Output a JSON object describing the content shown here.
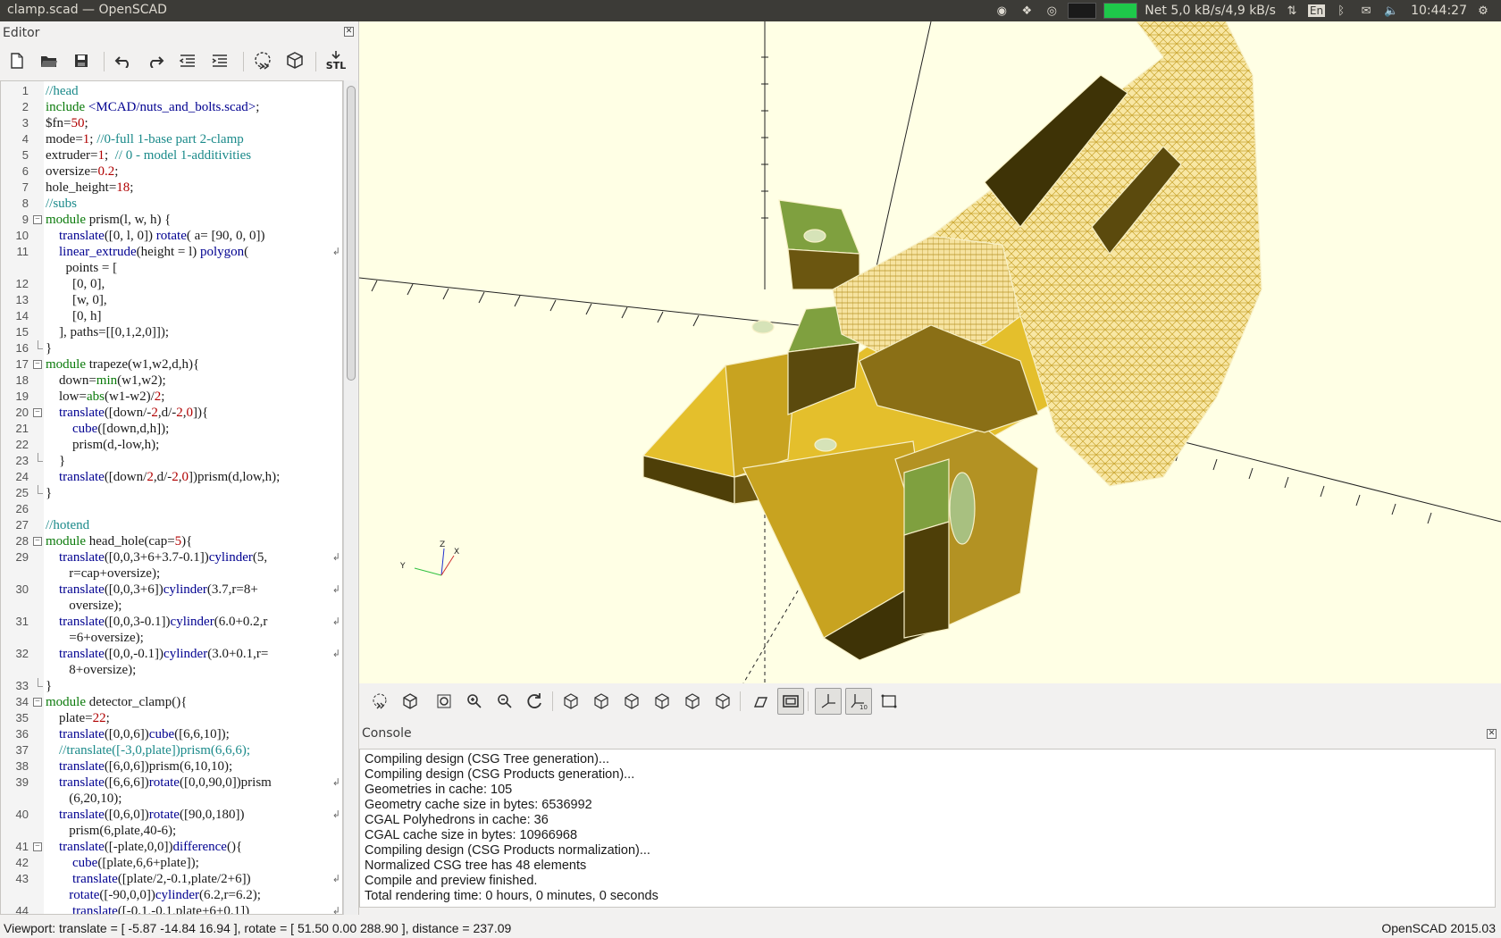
{
  "window": {
    "title": "clamp.scad — OpenSCAD"
  },
  "tray": {
    "net": "Net 5,0 kB/s/4,9 kB/s",
    "lang": "En",
    "time": "10:44:27"
  },
  "editor": {
    "title": "Editor",
    "toolbar": [
      "new-file-icon",
      "open-file-icon",
      "save-icon",
      "undo-icon",
      "redo-icon",
      "unindent-icon",
      "indent-icon",
      "preview-icon",
      "render-icon",
      "export-stl-icon"
    ],
    "stl_label": "STL",
    "lines": [
      {
        "n": "1",
        "fold": "",
        "segs": [
          [
            "c",
            "//head"
          ]
        ]
      },
      {
        "n": "2",
        "fold": "",
        "segs": [
          [
            "k",
            "include"
          ],
          [
            "t",
            " "
          ],
          [
            "f",
            "<MCAD/nuts_and_bolts.scad>"
          ],
          [
            "t",
            ";"
          ]
        ]
      },
      {
        "n": "3",
        "fold": "",
        "segs": [
          [
            "t",
            "$fn="
          ],
          [
            "n",
            "50"
          ],
          [
            "t",
            ";"
          ]
        ]
      },
      {
        "n": "4",
        "fold": "",
        "segs": [
          [
            "t",
            "mode="
          ],
          [
            "n",
            "1"
          ],
          [
            "t",
            "; "
          ],
          [
            "c",
            "//0-full 1-base part 2-clamp"
          ]
        ]
      },
      {
        "n": "5",
        "fold": "",
        "segs": [
          [
            "t",
            "extruder="
          ],
          [
            "n",
            "1"
          ],
          [
            "t",
            ";  "
          ],
          [
            "c",
            "// 0 - model 1-additivities"
          ]
        ]
      },
      {
        "n": "6",
        "fold": "",
        "segs": [
          [
            "t",
            "oversize="
          ],
          [
            "n",
            "0.2"
          ],
          [
            "t",
            ";"
          ]
        ]
      },
      {
        "n": "7",
        "fold": "",
        "segs": [
          [
            "t",
            "hole_height="
          ],
          [
            "n",
            "18"
          ],
          [
            "t",
            ";"
          ]
        ]
      },
      {
        "n": "8",
        "fold": "",
        "segs": [
          [
            "c",
            "//subs"
          ]
        ]
      },
      {
        "n": "9",
        "fold": "open",
        "segs": [
          [
            "k",
            "module"
          ],
          [
            "t",
            " prism(l, w, h) {"
          ]
        ]
      },
      {
        "n": "10",
        "fold": "",
        "segs": [
          [
            "t",
            "    "
          ],
          [
            "f",
            "translate"
          ],
          [
            "t",
            "([0, l, 0]) "
          ],
          [
            "f",
            "rotate"
          ],
          [
            "t",
            "( a= [90, 0, 0])"
          ]
        ]
      },
      {
        "n": "11",
        "fold": "",
        "wrap": true,
        "segs": [
          [
            "t",
            "    "
          ],
          [
            "f",
            "linear_extrude"
          ],
          [
            "t",
            "(height = l) "
          ],
          [
            "f",
            "polygon"
          ],
          [
            "t",
            "("
          ]
        ]
      },
      {
        "n": "",
        "fold": "",
        "segs": [
          [
            "t",
            "      points = ["
          ]
        ]
      },
      {
        "n": "12",
        "fold": "",
        "segs": [
          [
            "t",
            "        [0, 0],"
          ]
        ]
      },
      {
        "n": "13",
        "fold": "",
        "segs": [
          [
            "t",
            "        [w, 0],"
          ]
        ]
      },
      {
        "n": "14",
        "fold": "",
        "segs": [
          [
            "t",
            "        [0, h]"
          ]
        ]
      },
      {
        "n": "15",
        "fold": "",
        "segs": [
          [
            "t",
            "    ], paths=[[0,1,2,0]]);"
          ]
        ]
      },
      {
        "n": "16",
        "fold": "end",
        "segs": [
          [
            "t",
            "}"
          ]
        ]
      },
      {
        "n": "17",
        "fold": "open",
        "segs": [
          [
            "k",
            "module"
          ],
          [
            "t",
            " trapeze(w1,w2,d,h){"
          ]
        ]
      },
      {
        "n": "18",
        "fold": "",
        "segs": [
          [
            "t",
            "    down="
          ],
          [
            "k",
            "min"
          ],
          [
            "t",
            "(w1,w2);"
          ]
        ]
      },
      {
        "n": "19",
        "fold": "",
        "segs": [
          [
            "t",
            "    low="
          ],
          [
            "k",
            "abs"
          ],
          [
            "t",
            "(w1-w2)/"
          ],
          [
            "n",
            "2"
          ],
          [
            "t",
            ";"
          ]
        ]
      },
      {
        "n": "20",
        "fold": "open",
        "segs": [
          [
            "t",
            "    "
          ],
          [
            "f",
            "translate"
          ],
          [
            "t",
            "([down/-"
          ],
          [
            "n",
            "2"
          ],
          [
            "t",
            ",d/-"
          ],
          [
            "n",
            "2"
          ],
          [
            "t",
            ","
          ],
          [
            "n",
            "0"
          ],
          [
            "t",
            "]){"
          ]
        ]
      },
      {
        "n": "21",
        "fold": "",
        "segs": [
          [
            "t",
            "        "
          ],
          [
            "f",
            "cube"
          ],
          [
            "t",
            "([down,d,h]);"
          ]
        ]
      },
      {
        "n": "22",
        "fold": "",
        "segs": [
          [
            "t",
            "        prism(d,-low,h);"
          ]
        ]
      },
      {
        "n": "23",
        "fold": "end",
        "segs": [
          [
            "t",
            "    }"
          ]
        ]
      },
      {
        "n": "24",
        "fold": "",
        "segs": [
          [
            "t",
            "    "
          ],
          [
            "f",
            "translate"
          ],
          [
            "t",
            "([down/"
          ],
          [
            "n",
            "2"
          ],
          [
            "t",
            ",d/-"
          ],
          [
            "n",
            "2"
          ],
          [
            "t",
            ","
          ],
          [
            "n",
            "0"
          ],
          [
            "t",
            "])prism(d,low,h);"
          ]
        ]
      },
      {
        "n": "25",
        "fold": "end",
        "segs": [
          [
            "t",
            "}"
          ]
        ]
      },
      {
        "n": "26",
        "fold": "",
        "segs": [
          [
            "t",
            ""
          ]
        ]
      },
      {
        "n": "27",
        "fold": "",
        "segs": [
          [
            "c",
            "//hotend"
          ]
        ]
      },
      {
        "n": "28",
        "fold": "open",
        "segs": [
          [
            "k",
            "module"
          ],
          [
            "t",
            " head_hole(cap="
          ],
          [
            "n",
            "5"
          ],
          [
            "t",
            "){"
          ]
        ]
      },
      {
        "n": "29",
        "fold": "",
        "wrap": true,
        "segs": [
          [
            "t",
            "    "
          ],
          [
            "f",
            "translate"
          ],
          [
            "t",
            "([0,0,3+6+3.7-0.1])"
          ],
          [
            "f",
            "cylinder"
          ],
          [
            "t",
            "(5,"
          ]
        ]
      },
      {
        "n": "",
        "fold": "",
        "segs": [
          [
            "t",
            "       r=cap+oversize);"
          ]
        ]
      },
      {
        "n": "30",
        "fold": "",
        "wrap": true,
        "segs": [
          [
            "t",
            "    "
          ],
          [
            "f",
            "translate"
          ],
          [
            "t",
            "([0,0,3+6])"
          ],
          [
            "f",
            "cylinder"
          ],
          [
            "t",
            "(3.7,r=8+"
          ]
        ]
      },
      {
        "n": "",
        "fold": "",
        "segs": [
          [
            "t",
            "       oversize);"
          ]
        ]
      },
      {
        "n": "31",
        "fold": "",
        "wrap": true,
        "segs": [
          [
            "t",
            "    "
          ],
          [
            "f",
            "translate"
          ],
          [
            "t",
            "([0,0,3-0.1])"
          ],
          [
            "f",
            "cylinder"
          ],
          [
            "t",
            "(6.0+0.2,r"
          ]
        ]
      },
      {
        "n": "",
        "fold": "",
        "segs": [
          [
            "t",
            "       =6+oversize);"
          ]
        ]
      },
      {
        "n": "32",
        "fold": "",
        "wrap": true,
        "segs": [
          [
            "t",
            "    "
          ],
          [
            "f",
            "translate"
          ],
          [
            "t",
            "([0,0,-0.1])"
          ],
          [
            "f",
            "cylinder"
          ],
          [
            "t",
            "(3.0+0.1,r="
          ]
        ]
      },
      {
        "n": "",
        "fold": "",
        "segs": [
          [
            "t",
            "       8+oversize);"
          ]
        ]
      },
      {
        "n": "33",
        "fold": "end",
        "segs": [
          [
            "t",
            "}"
          ]
        ]
      },
      {
        "n": "34",
        "fold": "open",
        "segs": [
          [
            "k",
            "module"
          ],
          [
            "t",
            " detector_clamp(){"
          ]
        ]
      },
      {
        "n": "35",
        "fold": "",
        "segs": [
          [
            "t",
            "    plate="
          ],
          [
            "n",
            "22"
          ],
          [
            "t",
            ";"
          ]
        ]
      },
      {
        "n": "36",
        "fold": "",
        "segs": [
          [
            "t",
            "    "
          ],
          [
            "f",
            "translate"
          ],
          [
            "t",
            "([0,0,6])"
          ],
          [
            "f",
            "cube"
          ],
          [
            "t",
            "([6,6,10]);"
          ]
        ]
      },
      {
        "n": "37",
        "fold": "",
        "segs": [
          [
            "t",
            "    "
          ],
          [
            "c",
            "//translate([-3,0,plate])prism(6,6,6);"
          ]
        ]
      },
      {
        "n": "38",
        "fold": "",
        "segs": [
          [
            "t",
            "    "
          ],
          [
            "f",
            "translate"
          ],
          [
            "t",
            "([6,0,6])prism(6,10,10);"
          ]
        ]
      },
      {
        "n": "39",
        "fold": "",
        "wrap": true,
        "segs": [
          [
            "t",
            "    "
          ],
          [
            "f",
            "translate"
          ],
          [
            "t",
            "([6,6,6])"
          ],
          [
            "f",
            "rotate"
          ],
          [
            "t",
            "([0,0,90,0])prism"
          ]
        ]
      },
      {
        "n": "",
        "fold": "",
        "segs": [
          [
            "t",
            "       (6,20,10);"
          ]
        ]
      },
      {
        "n": "40",
        "fold": "",
        "wrap": true,
        "segs": [
          [
            "t",
            "    "
          ],
          [
            "f",
            "translate"
          ],
          [
            "t",
            "([0,6,0])"
          ],
          [
            "f",
            "rotate"
          ],
          [
            "t",
            "([90,0,180])"
          ]
        ]
      },
      {
        "n": "",
        "fold": "",
        "segs": [
          [
            "t",
            "       prism(6,plate,40-6);"
          ]
        ]
      },
      {
        "n": "41",
        "fold": "open",
        "segs": [
          [
            "t",
            "    "
          ],
          [
            "f",
            "translate"
          ],
          [
            "t",
            "([-plate,0,0])"
          ],
          [
            "f",
            "difference"
          ],
          [
            "t",
            "(){"
          ]
        ]
      },
      {
        "n": "42",
        "fold": "",
        "segs": [
          [
            "t",
            "        "
          ],
          [
            "f",
            "cube"
          ],
          [
            "t",
            "([plate,6,6+plate]);"
          ]
        ]
      },
      {
        "n": "43",
        "fold": "",
        "wrap": true,
        "segs": [
          [
            "t",
            "        "
          ],
          [
            "f",
            "translate"
          ],
          [
            "t",
            "([plate/2,-0.1,plate/2+6])"
          ]
        ]
      },
      {
        "n": "",
        "fold": "",
        "segs": [
          [
            "t",
            "       "
          ],
          [
            "f",
            "rotate"
          ],
          [
            "t",
            "([-90,0,0])"
          ],
          [
            "f",
            "cylinder"
          ],
          [
            "t",
            "(6.2,r=6.2);"
          ]
        ]
      },
      {
        "n": "44",
        "fold": "",
        "wrap": true,
        "segs": [
          [
            "t",
            "        "
          ],
          [
            "f",
            "translate"
          ],
          [
            "t",
            "([-0.1,-0.1,plate+6+0.1])"
          ]
        ]
      }
    ]
  },
  "view": {
    "toolbar": [
      "preview-icon",
      "render-icon",
      "view-all-icon",
      "zoom-in-icon",
      "zoom-out-icon",
      "reset-view-icon",
      "view-right-icon",
      "view-top-icon",
      "view-bottom-icon",
      "view-left-icon",
      "view-front-icon",
      "view-back-icon",
      "perspective-icon",
      "orthogonal-icon",
      "show-axes-icon",
      "show-scale-markers-icon",
      "show-edges-icon"
    ],
    "axis_labels": {
      "x": "X",
      "y": "Y",
      "z": "Z"
    }
  },
  "console": {
    "title": "Console",
    "lines": [
      "Compiling design (CSG Tree generation)...",
      "Compiling design (CSG Products generation)...",
      "Geometries in cache: 105",
      "Geometry cache size in bytes: 6536992",
      "CGAL Polyhedrons in cache: 36",
      "CGAL cache size in bytes: 10966968",
      "Compiling design (CSG Products normalization)...",
      "Normalized CSG tree has 48 elements",
      "Compile and preview finished.",
      "Total rendering time: 0 hours, 0 minutes, 0 seconds"
    ]
  },
  "status": {
    "viewport": "Viewport: translate = [ -5.87 -14.84 16.94 ], rotate = [ 51.50 0.00 288.90 ], distance = 237.09",
    "version": "OpenSCAD 2015.03"
  },
  "colors": {
    "model_yellow": "#e8c531",
    "model_green": "#7fa03f",
    "viewport_bg": "#ffffe5"
  }
}
